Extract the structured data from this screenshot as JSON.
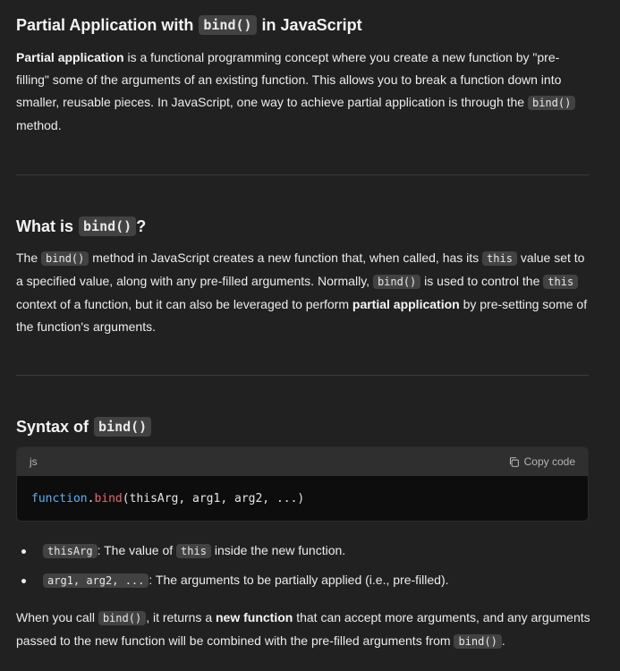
{
  "section1": {
    "title_before": "Partial Application with",
    "title_code": "bind()",
    "title_after": "in JavaScript",
    "p_bold": "Partial application",
    "p_text1": " is a functional programming concept where you create a new function by \"pre-filling\" some of the arguments of an existing function. This allows you to break a function down into smaller, reusable pieces. In JavaScript, one way to achieve partial application is through the ",
    "p_code": "bind()",
    "p_text2": " method."
  },
  "section2": {
    "title_before": "What is",
    "title_code": "bind()",
    "title_after": "?",
    "t1": "The ",
    "c1": "bind()",
    "t2": " method in JavaScript creates a new function that, when called, has its ",
    "c2": "this",
    "t3": " value set to a specified value, along with any pre-filled arguments. Normally, ",
    "c3": "bind()",
    "t4": " is used to control the ",
    "c4": "this",
    "t5": " context of a function, but it can also be leveraged to perform ",
    "b1": "partial application",
    "t6": " by pre-setting some of the function's arguments."
  },
  "section3": {
    "title_before": "Syntax of",
    "title_code": "bind()",
    "codeblock": {
      "lang": "js",
      "copy_label": "Copy code",
      "code_kw": "function",
      "code_dot": ".",
      "code_fn": "bind",
      "code_rest": "(thisArg, arg1, arg2, ...)"
    },
    "bullets": [
      {
        "code": "thisArg",
        "text": ": The value of ",
        "code2": "this",
        "text2": " inside the new function."
      },
      {
        "code": "arg1, arg2, ...",
        "text": ": The arguments to be partially applied (i.e., pre-filled)."
      }
    ],
    "closing": {
      "t1": "When you call ",
      "c1": "bind()",
      "t2": ", it returns a ",
      "b1": "new function",
      "t3": " that can accept more arguments, and any arguments passed to the new function will be combined with the pre-filled arguments from ",
      "c2": "bind()",
      "t4": "."
    }
  }
}
